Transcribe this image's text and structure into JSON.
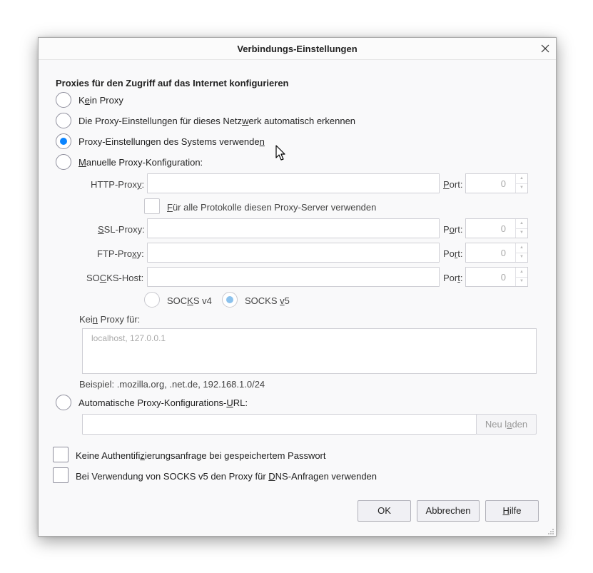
{
  "window": {
    "title": "Verbindungs-Einstellungen"
  },
  "section": {
    "heading": "Proxies für den Zugriff auf das Internet konfigurieren"
  },
  "options": {
    "no_proxy": {
      "pre": "K",
      "key": "e",
      "post": "in Proxy",
      "checked": false
    },
    "auto_detect": {
      "pre": "Die Proxy-Einstellungen für dieses Netz",
      "key": "w",
      "post": "erk automatisch erkennen",
      "checked": false
    },
    "system": {
      "pre": "Proxy-Einstellungen des Systems verwende",
      "key": "n",
      "post": "",
      "checked": true
    },
    "manual": {
      "pre": "",
      "key": "M",
      "post": "anuelle Proxy-Konfiguration:",
      "checked": false
    },
    "auto_url": {
      "pre": "Automatische Proxy-Konfigurations-",
      "key": "U",
      "post": "RL:",
      "checked": false
    }
  },
  "manual": {
    "http": {
      "pre": "HTTP-Prox",
      "key": "y",
      "post": ":",
      "value": "",
      "port_pre": "",
      "port_key": "P",
      "port_post": "ort:",
      "port": "0"
    },
    "share": {
      "pre": "",
      "key": "F",
      "post": "ür alle Protokolle diesen Proxy-Server verwenden"
    },
    "ssl": {
      "pre": "",
      "key": "S",
      "post": "SL-Proxy:",
      "value": "",
      "port_pre": "P",
      "port_key": "o",
      "port_post": "rt:",
      "port": "0"
    },
    "ftp": {
      "pre": "FTP-Pro",
      "key": "x",
      "post": "y:",
      "value": "",
      "port_pre": "Po",
      "port_key": "r",
      "port_post": "t:",
      "port": "0"
    },
    "socks": {
      "pre": "SO",
      "key": "C",
      "post": "KS-Host:",
      "value": "",
      "port_pre": "Por",
      "port_key": "t",
      "port_post": ":",
      "port": "0"
    },
    "socks_v4": {
      "pre": "SOC",
      "key": "K",
      "post": "S v4",
      "checked": false
    },
    "socks_v5": {
      "pre": "SOCKS ",
      "key": "v",
      "post": "5",
      "checked": true
    }
  },
  "no_proxy_for": {
    "pre": "Kei",
    "key": "n",
    "post": " Proxy für:",
    "placeholder": "localhost, 127.0.0.1",
    "example": "Beispiel: .mozilla.org, .net.de, 192.168.1.0/24"
  },
  "auto_url": {
    "value": "",
    "reload_pre": "Neu l",
    "reload_key": "a",
    "reload_post": "den"
  },
  "checkboxes": {
    "no_auth": {
      "pre": "Keine Authentifi",
      "key": "z",
      "post": "ierungsanfrage bei gespeichertem Passwort",
      "checked": false
    },
    "socks_dns": {
      "pre": "Bei Verwendung von SOCKS v5 den Proxy für ",
      "key": "D",
      "post": "NS-Anfragen verwenden",
      "checked": false
    }
  },
  "buttons": {
    "ok": "OK",
    "cancel": "Abbrechen",
    "help_key": "H",
    "help_post": "ilfe"
  },
  "colors": {
    "accent": "#0a84ff",
    "accent_disabled": "#8cc2ed"
  },
  "icons": {
    "close": "close-icon",
    "cursor": "mouse-pointer-icon",
    "resize": "resize-grip-icon"
  }
}
